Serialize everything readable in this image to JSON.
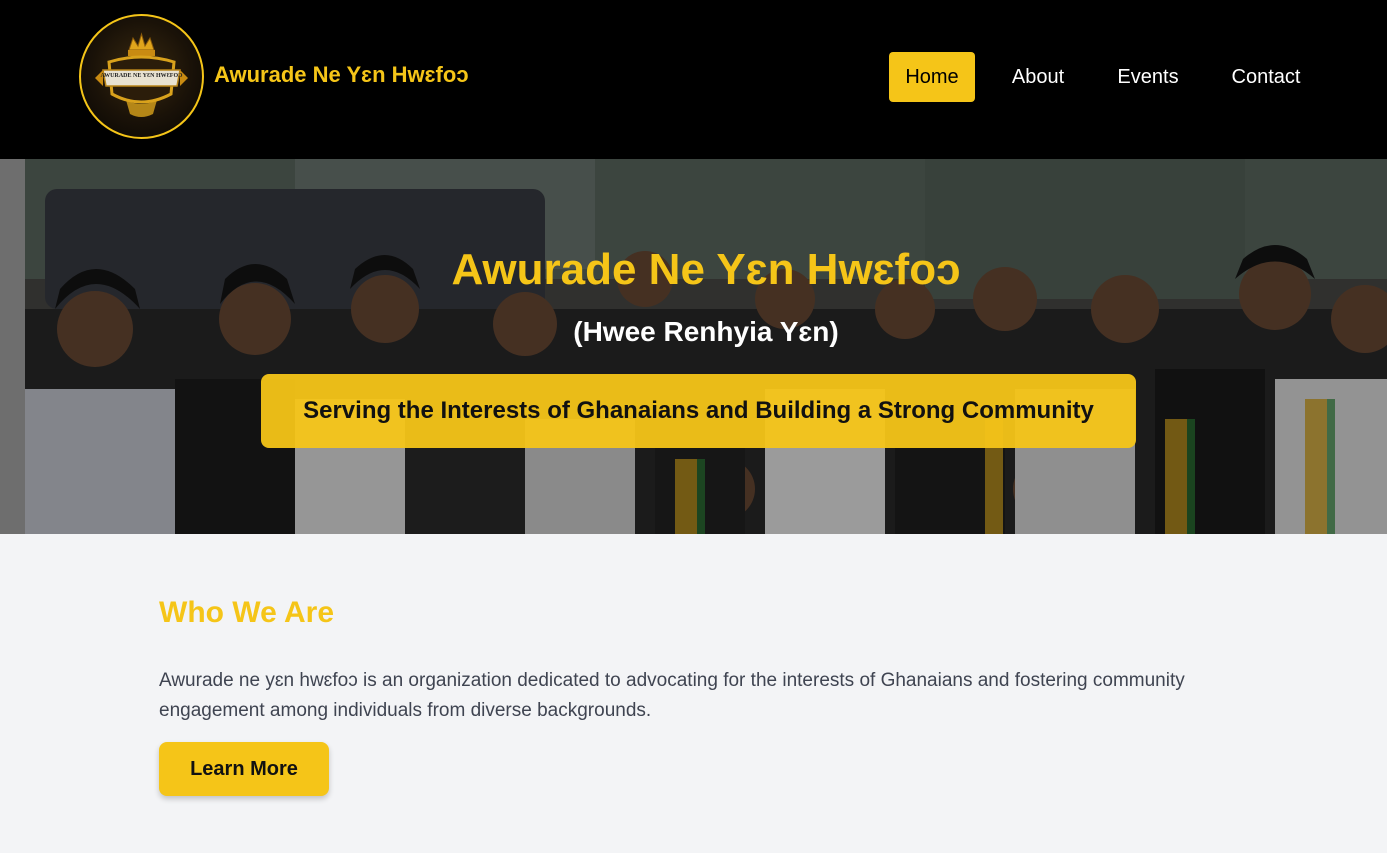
{
  "header": {
    "logo_text": "AWURADE NE YƐN HWƐFOƆ",
    "brand": "Awurade Ne Yɛn Hwɛfoɔ",
    "nav": [
      {
        "label": "Home",
        "active": true
      },
      {
        "label": "About",
        "active": false
      },
      {
        "label": "Events",
        "active": false
      },
      {
        "label": "Contact",
        "active": false
      }
    ]
  },
  "hero": {
    "title": "Awurade Ne Yɛn Hwɛfoɔ",
    "subtitle": "(Hwee Renhyia Yɛn)",
    "tagline": "Serving the Interests of Ghanaians and Building a Strong Community"
  },
  "about": {
    "title": "Who We Are",
    "text": "Awurade ne yɛn hwɛfoɔ is an organization dedicated to advocating for the interests of Ghanaians and fostering community engagement among individuals from diverse backgrounds.",
    "button": "Learn More"
  },
  "colors": {
    "accent": "#f5c518",
    "header_bg": "#000000",
    "page_bg": "#f3f4f6"
  }
}
